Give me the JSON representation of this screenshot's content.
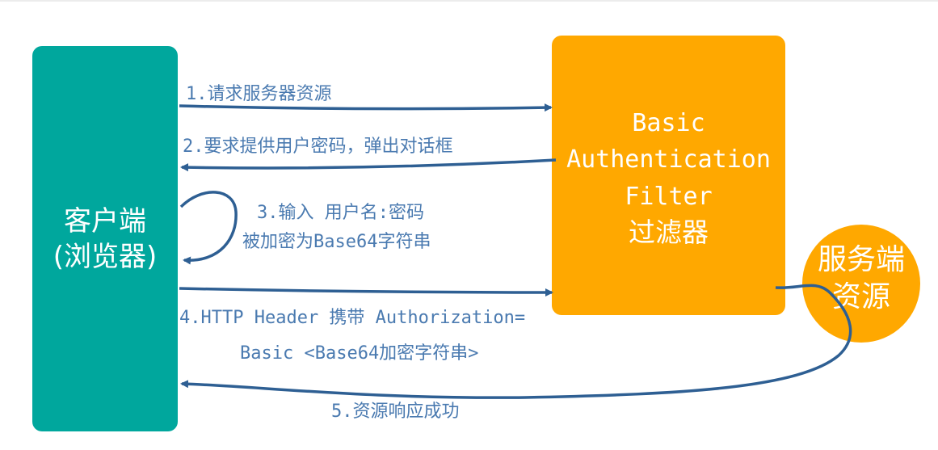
{
  "client": {
    "line1": "客户端",
    "line2": "(浏览器)"
  },
  "filter": {
    "line1": "Basic",
    "line2": "Authentication",
    "line3": "Filter",
    "line4": "过滤器"
  },
  "resource": {
    "line1": "服务端",
    "line2": "资源"
  },
  "steps": {
    "step1": "1.请求服务器资源",
    "step2": "2.要求提供用户密码，弹出对话框",
    "step3_line1": "3.输入 用户名:密码",
    "step3_line2": "被加密为Base64字符串",
    "step4_line1": "4.HTTP Header 携带 Authorization=",
    "step4_line2": "Basic <Base64加密字符串>",
    "step5": "5.资源响应成功"
  },
  "colors": {
    "client": "#00a79d",
    "filter": "#ffa800",
    "resource": "#ffa800",
    "arrow": "#2e5f93",
    "label": "#4a7ab0"
  }
}
